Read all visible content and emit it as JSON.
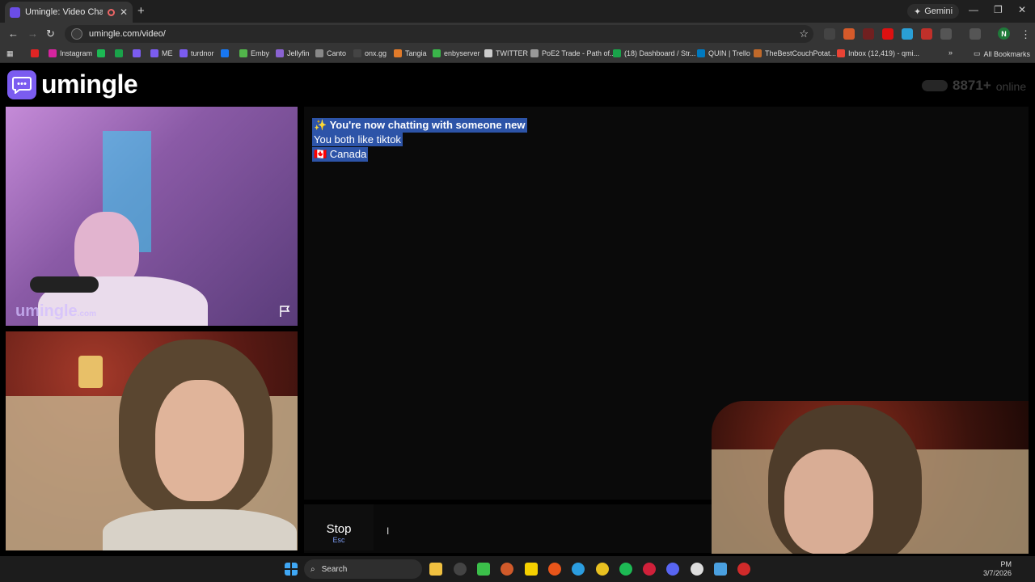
{
  "browser": {
    "tab_title": "Umingle: Video Chat with S",
    "new_tab": "+",
    "gemini_label": "Gemini",
    "url": "umingle.com/video/",
    "all_bookmarks": "All Bookmarks",
    "profile_initial": "N",
    "bookmarks": [
      {
        "label": "",
        "color": "#e02424"
      },
      {
        "label": "Instagram",
        "color": "#d6249f"
      },
      {
        "label": "",
        "color": "#1db954"
      },
      {
        "label": "",
        "color": "#1aa34a"
      },
      {
        "label": "",
        "color": "#7b5cf0"
      },
      {
        "label": "ME",
        "color": "#7b5cf0"
      },
      {
        "label": "turdnor",
        "color": "#7b5cf0"
      },
      {
        "label": "",
        "color": "#1877f2"
      },
      {
        "label": "Emby",
        "color": "#52b54b"
      },
      {
        "label": "Jellyfin",
        "color": "#8a63d2"
      },
      {
        "label": "Canto",
        "color": "#888888"
      },
      {
        "label": "onx.gg",
        "color": "#444444"
      },
      {
        "label": "Tangia",
        "color": "#e07a2a"
      },
      {
        "label": "enbyserver",
        "color": "#3ab54a"
      },
      {
        "label": "TWITTER",
        "color": "#cccccc"
      },
      {
        "label": "PoE2 Trade - Path of...",
        "color": "#999999"
      },
      {
        "label": "(18) Dashboard / Str...",
        "color": "#1aa34a"
      },
      {
        "label": "QUIN | Trello",
        "color": "#0079bf"
      },
      {
        "label": "TheBestCouchPotat...",
        "color": "#c0692a"
      },
      {
        "label": "Inbox (12,419) - qmi...",
        "color": "#ea4335"
      }
    ]
  },
  "site": {
    "brand": "umingle",
    "online_count": "8871+",
    "online_label": "online",
    "watermark": "umingle",
    "watermark_suffix": ".com"
  },
  "chat": {
    "lines": [
      {
        "text": "✨ You're now chatting with someone new",
        "bold": true
      },
      {
        "text": "You both like tiktok",
        "bold": false
      },
      {
        "text": "🇨🇦 Canada",
        "bold": false
      }
    ]
  },
  "controls": {
    "stop_label": "Stop",
    "stop_hint": "Esc",
    "message_placeholder": ""
  },
  "taskbar": {
    "search_label": "Search",
    "time": "PM",
    "date": "3/7/2026"
  }
}
